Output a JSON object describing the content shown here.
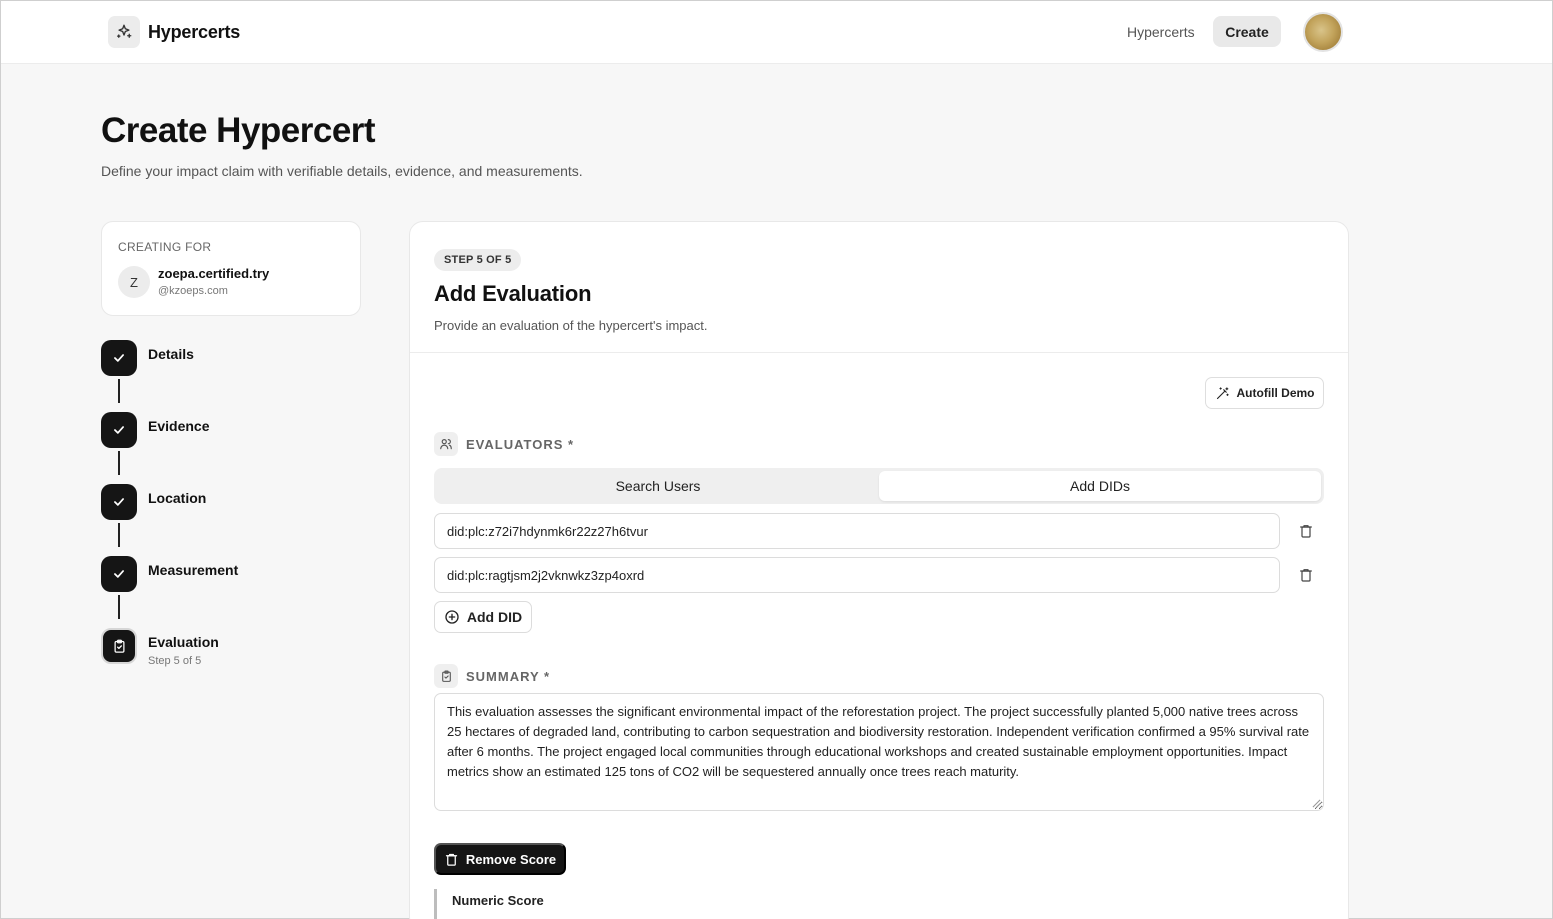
{
  "header": {
    "brand": "Hypercerts",
    "nav_link": "Hypercerts",
    "nav_create": "Create"
  },
  "page": {
    "title": "Create Hypercert",
    "subtitle": "Define your impact claim with verifiable details, evidence, and measurements."
  },
  "creating_for": {
    "label": "CREATING FOR",
    "initial": "Z",
    "name": "zoepa.certified.try",
    "handle": "@kzoeps.com"
  },
  "steps": [
    {
      "label": "Details",
      "status": "complete"
    },
    {
      "label": "Evidence",
      "status": "complete"
    },
    {
      "label": "Location",
      "status": "complete"
    },
    {
      "label": "Measurement",
      "status": "complete"
    },
    {
      "label": "Evaluation",
      "status": "current",
      "meta": "Step 5 of 5"
    }
  ],
  "card": {
    "badge": "STEP 5 OF 5",
    "title": "Add Evaluation",
    "subtitle": "Provide an evaluation of the hypercert's impact.",
    "autofill": "Autofill Demo"
  },
  "evaluators": {
    "title": "EVALUATORS *",
    "tabs": [
      {
        "label": "Search Users",
        "active": false
      },
      {
        "label": "Add DIDs",
        "active": true
      }
    ],
    "dids": [
      "did:plc:z72i7hdynmk6r22z27h6tvur",
      "did:plc:ragtjsm2j2vknwkz3zp4oxrd"
    ],
    "add_label": "Add DID"
  },
  "summary": {
    "title": "SUMMARY *",
    "text": "This evaluation assesses the significant environmental impact of the reforestation project. The project successfully planted 5,000 native trees across 25 hectares of degraded land, contributing to carbon sequestration and biodiversity restoration. Independent verification confirmed a 95% survival rate after 6 months. The project engaged local communities through educational workshops and created sustainable employment opportunities. Impact metrics show an estimated 125 tons of CO2 will be sequestered annually once trees reach maturity."
  },
  "score": {
    "remove_label": "Remove Score",
    "numeric_label": "Numeric Score"
  }
}
